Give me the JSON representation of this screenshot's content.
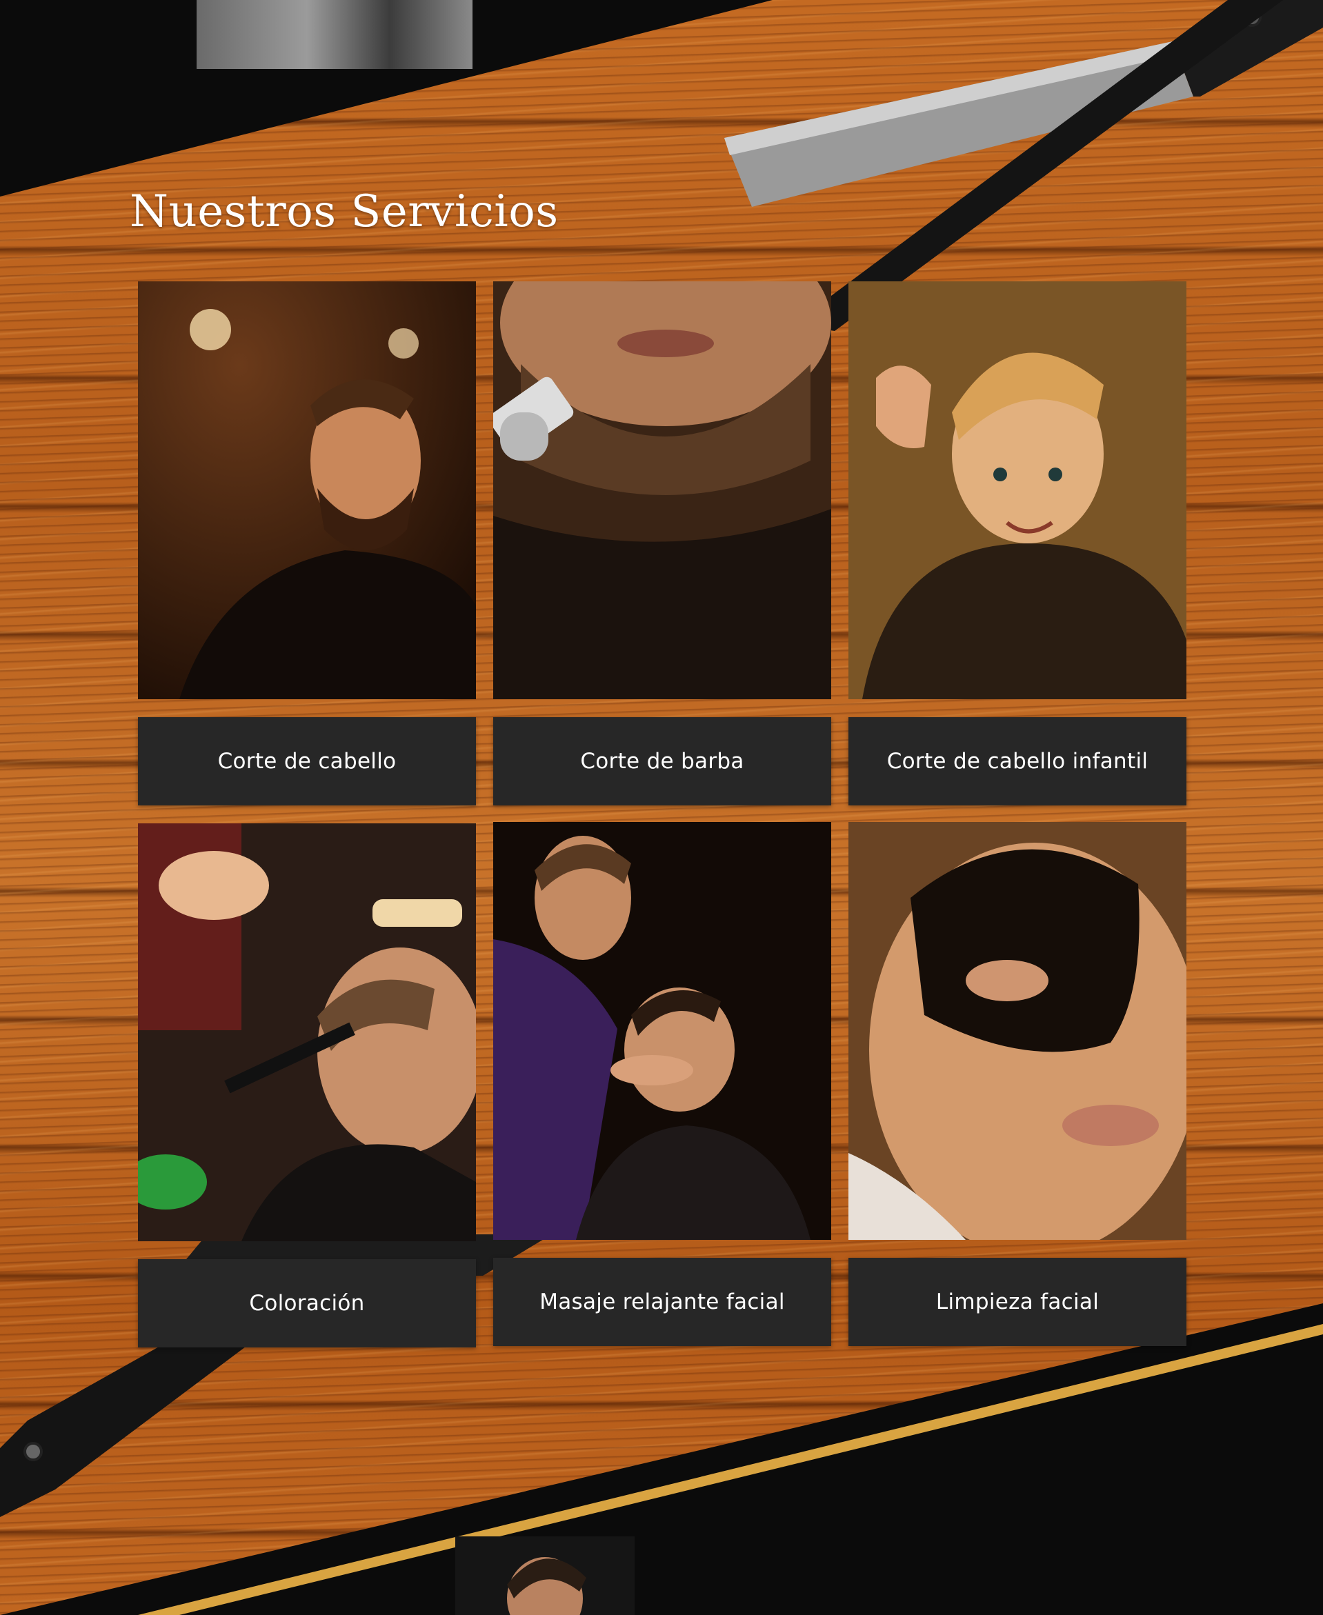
{
  "section": {
    "title": "Nuestros Servicios"
  },
  "services": [
    {
      "label": "Corte de cabello"
    },
    {
      "label": "Corte de barba"
    },
    {
      "label": "Corte de cabello infantil"
    },
    {
      "label": "Coloración"
    },
    {
      "label": "Masaje relajante facial"
    },
    {
      "label": "Limpieza facial"
    }
  ],
  "colors": {
    "wood": "#c46a22",
    "dark_band": "#0b0b0b",
    "label_bg": "#272727",
    "gold_accent": "#d9a441",
    "text": "#ffffff"
  }
}
